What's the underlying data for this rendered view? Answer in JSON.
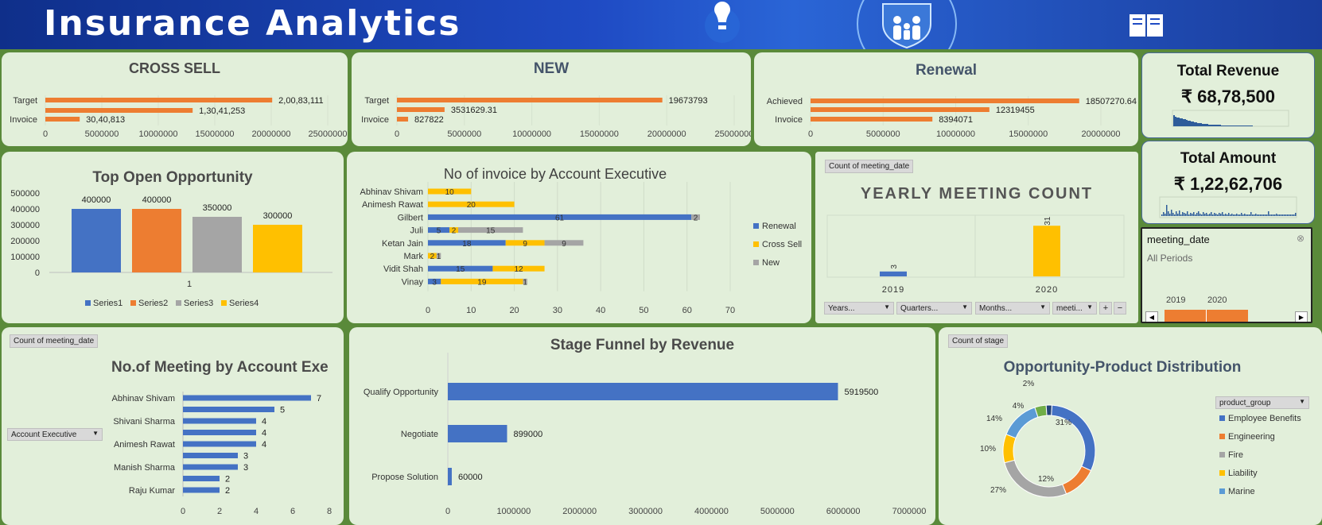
{
  "banner": {
    "title": "Insurance Analytics"
  },
  "colors": {
    "orange": "#ed7d31",
    "blue": "#4472c4",
    "gray": "#a5a5a5",
    "yellow": "#ffc000",
    "green": "#70ad47",
    "lightblue": "#5b9bd5",
    "panel": "#e2efda",
    "bg": "#5a8a3a"
  },
  "cross_sell": {
    "title": "CROSS SELL",
    "chart_data": {
      "type": "bar",
      "orientation": "horizontal",
      "categories": [
        "Target",
        "",
        "Invoice"
      ],
      "values": [
        20083111,
        13041253,
        3040813
      ],
      "labels": [
        "2,00,83,111",
        "1,30,41,253",
        "30,40,813"
      ],
      "xlim": [
        0,
        25000000
      ],
      "ticks": [
        "0",
        "5000000",
        "10000000",
        "15000000",
        "20000000",
        "25000000"
      ]
    }
  },
  "new": {
    "title": "NEW",
    "chart_data": {
      "type": "bar",
      "orientation": "horizontal",
      "categories": [
        "Target",
        "",
        "Invoice"
      ],
      "values": [
        19673793,
        3531629.31,
        827822
      ],
      "labels": [
        "19673793",
        "3531629.31",
        "827822"
      ],
      "xlim": [
        0,
        25000000
      ],
      "ticks": [
        "0",
        "5000000",
        "10000000",
        "15000000",
        "20000000",
        "25000000"
      ]
    }
  },
  "renewal": {
    "title": "Renewal",
    "chart_data": {
      "type": "bar",
      "orientation": "horizontal",
      "categories": [
        "Achieved",
        "",
        "Invoice"
      ],
      "values": [
        18507270.64,
        12319455,
        8394071
      ],
      "labels": [
        "18507270.64",
        "12319455",
        "8394071"
      ],
      "xlim": [
        0,
        20000000
      ],
      "ticks": [
        "0",
        "5000000",
        "10000000",
        "15000000",
        "20000000"
      ]
    }
  },
  "total_revenue": {
    "title": "Total Revenue",
    "value": "₹ 68,78,500"
  },
  "total_amount": {
    "title": "Total Amount",
    "value": "₹ 1,22,62,706"
  },
  "top_open": {
    "title": "Top Open Opportunity",
    "chart_data": {
      "type": "bar",
      "categories": [
        "1"
      ],
      "series": [
        {
          "name": "Series1",
          "values": [
            400000
          ]
        },
        {
          "name": "Series2",
          "values": [
            400000
          ]
        },
        {
          "name": "Series3",
          "values": [
            350000
          ]
        },
        {
          "name": "Series4",
          "values": [
            300000
          ]
        }
      ],
      "labels": [
        "400000",
        "400000",
        "350000",
        "300000"
      ],
      "ylim": [
        0,
        500000
      ],
      "ticks": [
        "500000",
        "400000",
        "300000",
        "200000",
        "100000",
        "0"
      ]
    }
  },
  "invoice_exec": {
    "title": "No of invoice by Account Executive",
    "chart_data": {
      "type": "bar",
      "orientation": "horizontal",
      "stacked": true,
      "categories": [
        "Abhinav Shivam",
        "Animesh Rawat",
        "Gilbert",
        "Juli",
        "Ketan Jain",
        "Mark",
        "Vidit Shah",
        "Vinay"
      ],
      "series": [
        {
          "name": "Renewal",
          "values": [
            0,
            0,
            61,
            5,
            18,
            0,
            15,
            3
          ]
        },
        {
          "name": "Cross Sell",
          "values": [
            10,
            20,
            0,
            2,
            9,
            2,
            12,
            19
          ]
        },
        {
          "name": "New",
          "values": [
            0,
            0,
            2,
            15,
            9,
            1,
            0,
            1
          ]
        }
      ],
      "xlim": [
        0,
        70
      ],
      "ticks": [
        "0",
        "10",
        "20",
        "30",
        "40",
        "50",
        "60",
        "70"
      ],
      "legend": "right"
    }
  },
  "yearly_meeting": {
    "tag": "Count of meeting_date",
    "title": "YEARLY MEETING COUNT",
    "chart_data": {
      "type": "bar",
      "categories": [
        "2019",
        "2020"
      ],
      "values": [
        3,
        31
      ],
      "labels": [
        "3",
        "31"
      ],
      "ylim": [
        0,
        35
      ]
    },
    "filters": [
      "Years...",
      "Quarters...",
      "Months...",
      "meeti..."
    ]
  },
  "timeline": {
    "title": "meeting_date",
    "subtitle": "All Periods",
    "years": [
      "2019",
      "2020"
    ]
  },
  "meeting_exec": {
    "tag": "Count of meeting_date",
    "title": "No.of Meeting by Account Exe",
    "dropdown": "Account Executive",
    "chart_data": {
      "type": "bar",
      "orientation": "horizontal",
      "categories": [
        "Abhinav Shivam",
        "",
        "Shivani Sharma",
        "",
        "Animesh Rawat",
        "",
        "Manish Sharma",
        "",
        "Raju Kumar"
      ],
      "values": [
        7,
        5,
        4,
        4,
        4,
        3,
        3,
        2,
        2
      ],
      "xlim": [
        0,
        8
      ],
      "ticks": [
        "0",
        "2",
        "4",
        "6",
        "8"
      ]
    }
  },
  "stage_funnel": {
    "title": "Stage Funnel by Revenue",
    "chart_data": {
      "type": "bar",
      "orientation": "horizontal",
      "categories": [
        "Qualify Opportunity",
        "Negotiate",
        "Propose Solution"
      ],
      "values": [
        5919500,
        899000,
        60000
      ],
      "labels": [
        "5919500",
        "899000",
        "60000"
      ],
      "xlim": [
        0,
        7000000
      ],
      "ticks": [
        "0",
        "1000000",
        "2000000",
        "3000000",
        "4000000",
        "5000000",
        "6000000",
        "7000000"
      ]
    }
  },
  "product_dist": {
    "tag": "Count of stage",
    "title": "Opportunity-Product Distribution",
    "dropdown": "product_group",
    "chart_data": {
      "type": "pie",
      "donut": true,
      "categories": [
        "Employee Benefits",
        "Engineering",
        "Fire",
        "Liability",
        "Marine",
        "",
        ""
      ],
      "values": [
        31,
        12,
        27,
        10,
        14,
        4,
        2
      ],
      "labels": [
        "31%",
        "12%",
        "27%",
        "10%",
        "14%",
        "4%",
        "2%"
      ],
      "slice_colors": [
        "#4472c4",
        "#ed7d31",
        "#a5a5a5",
        "#ffc000",
        "#5b9bd5",
        "#70ad47",
        "#264478"
      ],
      "legend": [
        "Employee Benefits",
        "Engineering",
        "Fire",
        "Liability",
        "Marine"
      ]
    }
  }
}
